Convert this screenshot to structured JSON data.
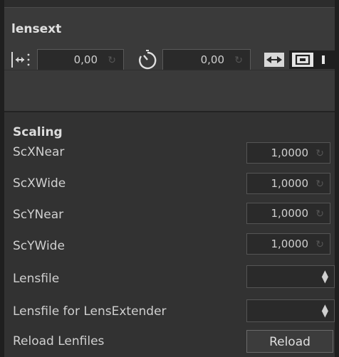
{
  "panel": {
    "title": "lensext",
    "offset_value": "0,00",
    "delay_value": "0,00"
  },
  "scaling": {
    "title": "Scaling",
    "rows": [
      {
        "label": "ScXNear",
        "value": "1,0000"
      },
      {
        "label": "ScXWide",
        "value": "1,0000"
      },
      {
        "label": "ScYNear",
        "value": "1,0000"
      },
      {
        "label": "ScYWide",
        "value": "1,0000"
      }
    ]
  },
  "lensfile": {
    "label": "Lensfile",
    "value": ""
  },
  "lensfile_extender": {
    "label": "Lensfile for LensExtender",
    "value": ""
  },
  "reload": {
    "label": "Reload Lenfiles",
    "button": "Reload"
  },
  "icons": {
    "offset": "horizontal-offset-icon",
    "delay": "timer-icon",
    "reset": "reset-icon",
    "swap": "swap-arrows-icon",
    "camera": "camera-icon",
    "toggle": "toggle-icon"
  },
  "colors": {
    "background": "#2c2c2c",
    "panel": "#3a3a3a",
    "field": "#2a2a2a",
    "text": "#d0d0d0"
  }
}
